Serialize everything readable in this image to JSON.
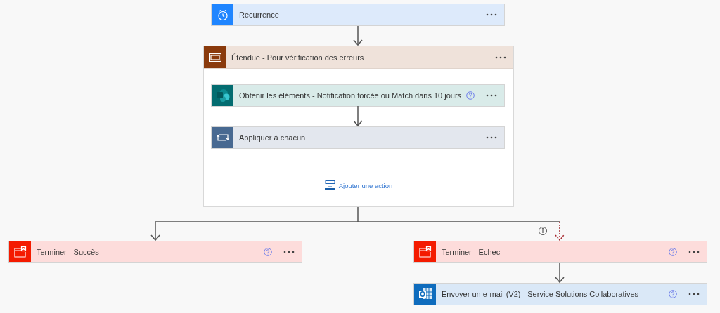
{
  "trigger": {
    "title": "Recurrence",
    "kind": "recurrence",
    "help": false
  },
  "scope": {
    "title": "Étendue - Pour vérification des erreurs",
    "kind": "scope",
    "help": false,
    "add_action": "Ajouter une action",
    "actions": [
      {
        "title": "Obtenir les éléments - Notification forcée ou Match dans 10 jours",
        "kind": "sharepoint",
        "help": true
      },
      {
        "title": "Appliquer à chacun",
        "kind": "foreach",
        "help": false
      }
    ]
  },
  "branches": [
    {
      "run_after_failed": false,
      "actions": [
        {
          "title": "Terminer - Succès",
          "kind": "terminate",
          "help": true
        }
      ]
    },
    {
      "run_after_failed": true,
      "actions": [
        {
          "title": "Terminer - Echec",
          "kind": "terminate",
          "help": true
        },
        {
          "title": "Envoyer un e-mail (V2) - Service Solutions Collaboratives",
          "kind": "outlook",
          "help": true
        }
      ]
    }
  ]
}
